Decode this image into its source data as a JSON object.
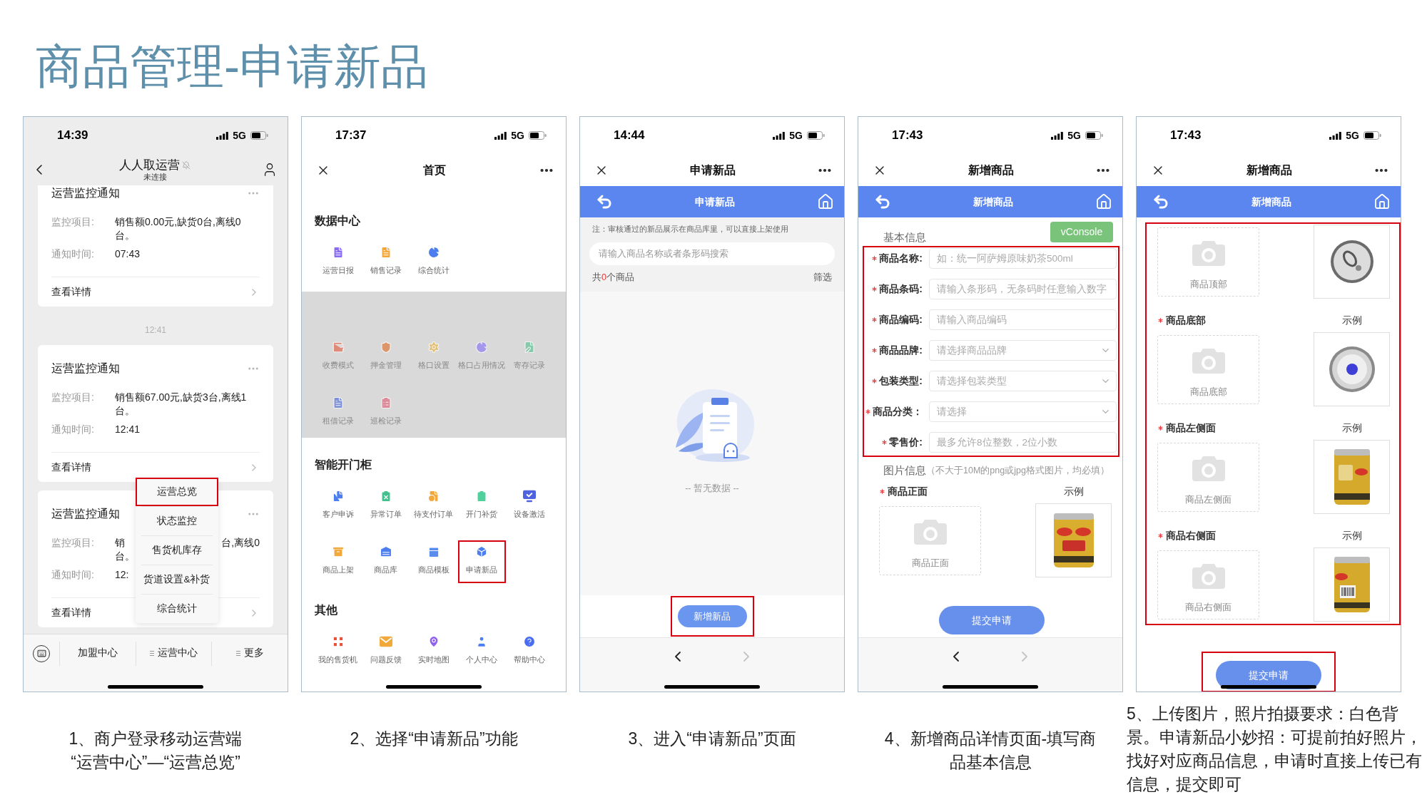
{
  "title": "商品管理-申请新品",
  "screens": [
    {
      "kind": "chat",
      "status_bar": {
        "time": "14:39",
        "network": "5G"
      },
      "nav": {
        "title": "人人取运营",
        "subtitle": "未连接",
        "muted": true
      },
      "messages": [
        {
          "kind": "card",
          "title": "运营监控通知",
          "rows": [
            {
              "label": "监控项目:",
              "value": "销售额0.00元,缺货0台,离线0台。"
            },
            {
              "label": "通知时间:",
              "value": "07:43"
            }
          ],
          "link": "查看详情"
        },
        {
          "kind": "time",
          "text": "12:41"
        },
        {
          "kind": "card",
          "title": "运营监控通知",
          "rows": [
            {
              "label": "监控项目:",
              "value": "销售额67.00元,缺货3台,离线1台。"
            },
            {
              "label": "通知时间:",
              "value": "12:41"
            }
          ],
          "link": "查看详情"
        },
        {
          "kind": "card",
          "title": "运营监控通知",
          "rows": [
            {
              "label": "监控项目:",
              "lines": [
                [
                  "销",
                  "台,离线0"
                ],
                [
                  "台。"
                ]
              ]
            },
            {
              "label": "通知时间:",
              "lines": [
                [
                  "12:"
                ]
              ]
            }
          ],
          "link": "查看详情"
        }
      ],
      "popup_menu": [
        {
          "label": "运营总览",
          "highlighted": true
        },
        {
          "label": "状态监控",
          "highlighted": false
        },
        {
          "label": "售货机库存",
          "highlighted": false
        },
        {
          "label": "货道设置&补货",
          "highlighted": false
        },
        {
          "label": "综合统计",
          "highlighted": false
        }
      ],
      "bottom_menu": [
        {
          "label": "加盟中心",
          "has_submenu": false
        },
        {
          "label": "运营中心",
          "has_submenu": true
        },
        {
          "label": "更多",
          "has_submenu": true
        }
      ]
    },
    {
      "kind": "grid",
      "status_bar": {
        "time": "17:37",
        "network": "5G"
      },
      "nav": {
        "title": "首页"
      },
      "sections": [
        {
          "title": "数据中心",
          "dimmed": false,
          "items": [
            {
              "label": "运营日报",
              "highlighted": false
            },
            {
              "label": "销售记录",
              "highlighted": false
            },
            {
              "label": "综合统计",
              "highlighted": false
            }
          ]
        },
        {
          "dimmed": true,
          "items": [
            {
              "label": "收费模式",
              "highlighted": false
            },
            {
              "label": "押金管理",
              "highlighted": false
            },
            {
              "label": "格口设置",
              "highlighted": false
            },
            {
              "label": "格口占用情况",
              "highlighted": false
            },
            {
              "label": "寄存记录",
              "highlighted": false
            },
            {
              "label": "租借记录",
              "highlighted": false
            },
            {
              "label": "巡检记录",
              "highlighted": false
            }
          ]
        },
        {
          "title": "智能开门柜",
          "dimmed": false,
          "items": [
            {
              "label": "客户申诉",
              "highlighted": false
            },
            {
              "label": "异常订单",
              "highlighted": false
            },
            {
              "label": "待支付订单",
              "highlighted": false
            },
            {
              "label": "开门补货",
              "highlighted": false
            },
            {
              "label": "设备激活",
              "highlighted": false
            },
            {
              "label": "商品上架",
              "highlighted": false
            },
            {
              "label": "商品库",
              "highlighted": false
            },
            {
              "label": "商品模板",
              "highlighted": false
            },
            {
              "label": "申请新品",
              "highlighted": true
            }
          ]
        },
        {
          "title": "其他",
          "dimmed": false,
          "items": [
            {
              "label": "我的售货机",
              "highlighted": false
            },
            {
              "label": "问题反馈",
              "highlighted": false
            },
            {
              "label": "实时地图",
              "highlighted": false
            },
            {
              "label": "个人中心",
              "highlighted": false
            },
            {
              "label": "帮助中心",
              "highlighted": false
            }
          ]
        }
      ]
    },
    {
      "kind": "list",
      "status_bar": {
        "time": "14:44",
        "network": "5G"
      },
      "nav": {
        "title": "申请新品"
      },
      "header_bar": {
        "title": "申请新品"
      },
      "note": "注：审核通过的新品展示在商品库里，可以直接上架使用",
      "search": {
        "placeholder": "请输入商品名称或者条形码搜索"
      },
      "count": {
        "before": "共",
        "number": "0",
        "after": "个商品"
      },
      "filter": "筛选",
      "empty_text": "-- 暂无数据 --",
      "action": {
        "label": "新增新品",
        "highlighted": true
      },
      "browser": {
        "back_disabled": false,
        "forward_disabled": true
      }
    },
    {
      "kind": "form",
      "status_bar": {
        "time": "17:43",
        "network": "5G"
      },
      "nav": {
        "title": "新增商品"
      },
      "header_bar": {
        "title": "新增商品"
      },
      "section_title": "基本信息",
      "console_button": "vConsole",
      "fields_highlighted": true,
      "fields": [
        {
          "kind": "input",
          "label": "商品名称:",
          "required": true,
          "placeholder": "如：统一阿萨姆原味奶茶500ml"
        },
        {
          "kind": "input",
          "label": "商品条码:",
          "required": true,
          "placeholder": "请输入条形码，无条码时任意输入数字"
        },
        {
          "kind": "input",
          "label": "商品编码:",
          "required": true,
          "placeholder": "请输入商品编码"
        },
        {
          "kind": "select",
          "label": "商品品牌:",
          "required": true,
          "placeholder": "请选择商品品牌"
        },
        {
          "kind": "select",
          "label": "包装类型:",
          "required": true,
          "placeholder": "请选择包装类型"
        },
        {
          "kind": "select",
          "label": "商品分类：",
          "required": true,
          "placeholder": "请选择"
        },
        {
          "kind": "input",
          "label": "零售价:",
          "required": true,
          "placeholder": "最多允许8位整数，2位小数"
        }
      ],
      "image_section": {
        "title": "图片信息",
        "hint": "（不大于10M的png或jpg格式图片，均必填）"
      },
      "uploads": [
        {
          "kind": "front",
          "label": "商品正面",
          "required": true,
          "example_label": "示例",
          "box_text": "商品正面"
        }
      ],
      "submit": {
        "label": "提交申请"
      },
      "browser": {
        "back_disabled": false,
        "forward_disabled": true
      }
    },
    {
      "kind": "uploads",
      "status_bar": {
        "time": "17:43",
        "network": "5G"
      },
      "nav": {
        "title": "新增商品"
      },
      "header_bar": {
        "title": "新增商品"
      },
      "uploads_highlighted": true,
      "uploads": [
        {
          "kind": "top",
          "box_text": "商品顶部"
        },
        {
          "kind": "bottom",
          "label": "商品底部",
          "required": true,
          "example_label": "示例",
          "box_text": "商品底部"
        },
        {
          "kind": "left",
          "label": "商品左侧面",
          "required": true,
          "example_label": "示例",
          "box_text": "商品左侧面"
        },
        {
          "kind": "right",
          "label": "商品右侧面",
          "required": true,
          "example_label": "示例",
          "box_text": "商品右侧面"
        }
      ],
      "submit": {
        "label": "提交申请",
        "highlighted": true
      }
    }
  ],
  "captions": [
    "1、商户登录移动运营端“运营中心”—“运营总览”",
    "2、选择“申请新品”功能",
    "3、进入“申请新品”页面",
    "4、新增商品详情页面-填写商品基本信息",
    "5、上传图片，照片拍摄要求：白色背景。申请新品小妙招：可提前拍好照片，找好对应商品信息，申请时直接上传已有信息，提交即可"
  ]
}
